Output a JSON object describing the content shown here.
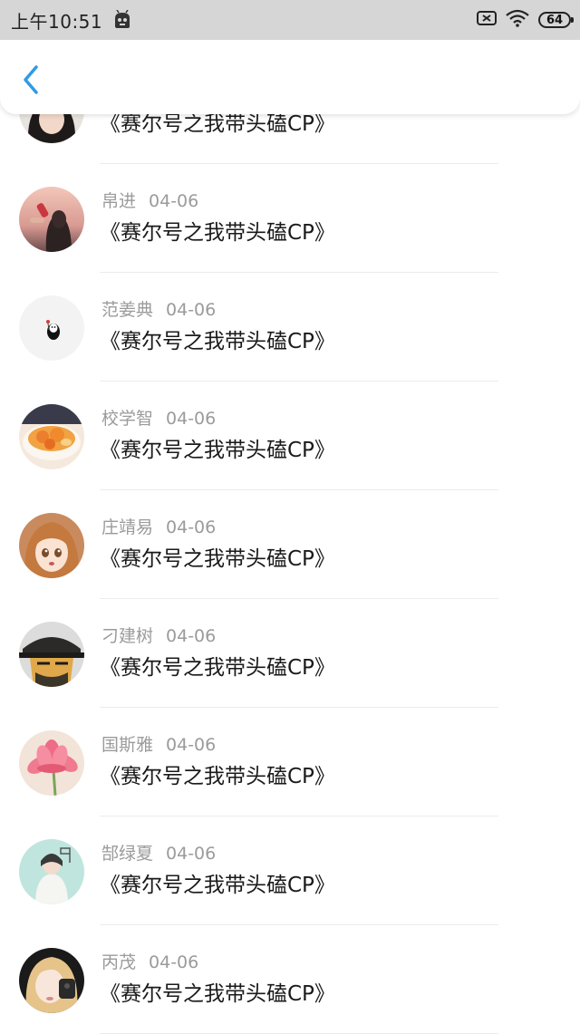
{
  "status_bar": {
    "time": "上午10:51",
    "battery": "64"
  },
  "feed": {
    "items": [
      {
        "name": "",
        "date": "",
        "title": "《赛尔号之我带头磕CP》",
        "avatar": "dark-hair-girl"
      },
      {
        "name": "帛进",
        "date": "04-06",
        "title": "《赛尔号之我带头磕CP》",
        "avatar": "girl-drinking-sunset"
      },
      {
        "name": "范姜典",
        "date": "04-06",
        "title": "《赛尔号之我带头磕CP》",
        "avatar": "no-face-ghost"
      },
      {
        "name": "校学智",
        "date": "04-06",
        "title": "《赛尔号之我带头磕CP》",
        "avatar": "orange-dessert"
      },
      {
        "name": "庄靖易",
        "date": "04-06",
        "title": "《赛尔号之我带头磕CP》",
        "avatar": "anime-girl"
      },
      {
        "name": "刁建树",
        "date": "04-06",
        "title": "《赛尔号之我带头磕CP》",
        "avatar": "cartoon-man-hat"
      },
      {
        "name": "国斯雅",
        "date": "04-06",
        "title": "《赛尔号之我带头磕CP》",
        "avatar": "pink-lotus"
      },
      {
        "name": "郜绿夏",
        "date": "04-06",
        "title": "《赛尔号之我带头磕CP》",
        "avatar": "girl-mint-background"
      },
      {
        "name": "丙茂",
        "date": "04-06",
        "title": "《赛尔号之我带头磕CP》",
        "avatar": "blonde-selfie"
      }
    ]
  },
  "colors": {
    "accent": "#2f9be6",
    "meta_text": "#9b9b9b",
    "status_bar_bg": "#d6d6d6"
  }
}
